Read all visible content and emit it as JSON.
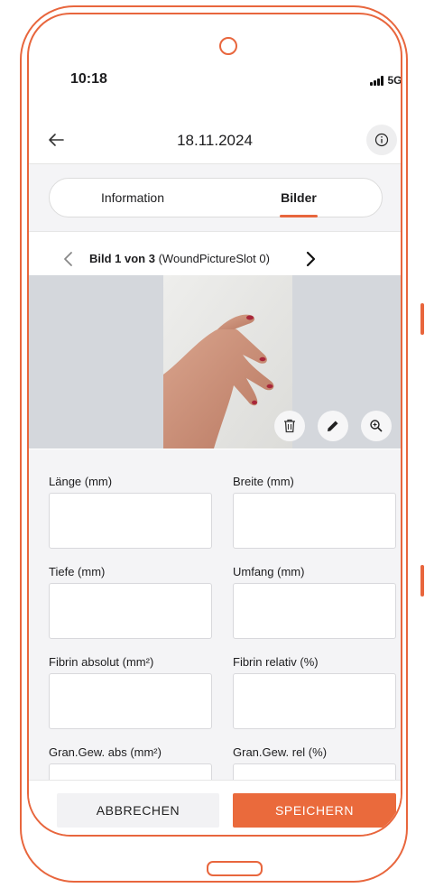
{
  "status_bar": {
    "time": "10:18",
    "network": "5G"
  },
  "header": {
    "title": "18.11.2024",
    "back_icon": "arrow-left-icon",
    "info_icon": "info-circle-icon"
  },
  "tabs": [
    {
      "label": "Information",
      "active": false
    },
    {
      "label": "Bilder",
      "active": true
    }
  ],
  "picture_nav": {
    "counter": "Bild 1 von 3",
    "slot": "(WoundPictureSlot 0)"
  },
  "photo_tools": [
    "trash-icon",
    "pencil-icon",
    "zoom-in-icon"
  ],
  "form": {
    "fields": [
      {
        "label": "Länge (mm)",
        "value": ""
      },
      {
        "label": "Breite (mm)",
        "value": ""
      },
      {
        "label": "Tiefe (mm)",
        "value": ""
      },
      {
        "label": "Umfang (mm)",
        "value": ""
      },
      {
        "label": "Fibrin absolut (mm²)",
        "value": ""
      },
      {
        "label": "Fibrin relativ (%)",
        "value": ""
      },
      {
        "label": "Gran.Gew. abs (mm²)",
        "value": ""
      },
      {
        "label": "Gran.Gew. rel (%)",
        "value": ""
      }
    ]
  },
  "footer": {
    "cancel_label": "ABBRECHEN",
    "save_label": "SPEICHERN"
  },
  "colors": {
    "accent": "#e8663d",
    "background": "#f4f4f6"
  }
}
